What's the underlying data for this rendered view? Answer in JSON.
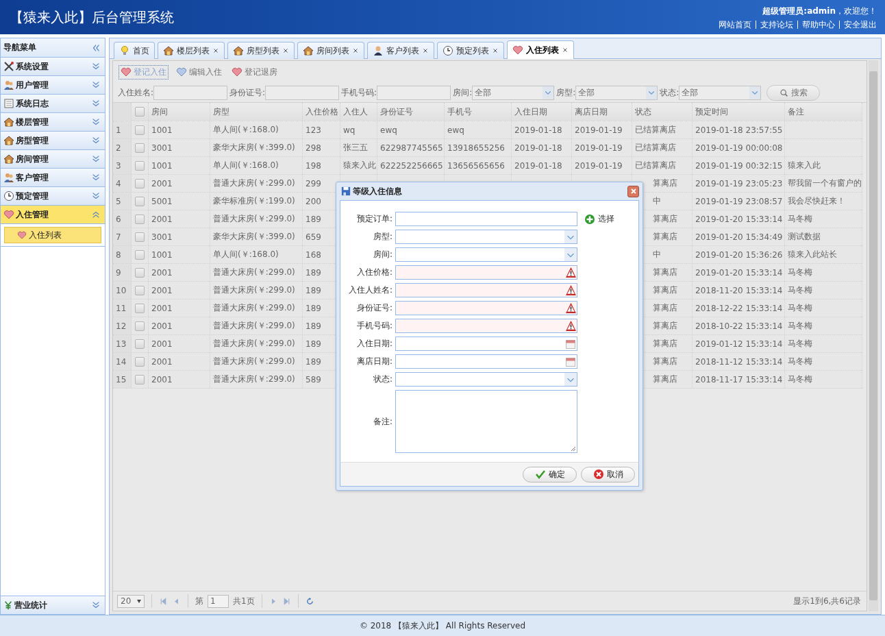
{
  "header": {
    "title": "【猿来入此】后台管理系统",
    "welcome": "**超级管理员:admin**，欢迎您！",
    "links": [
      "网站首页",
      "支持论坛",
      "帮助中心",
      "安全退出"
    ]
  },
  "sidebar": {
    "title": "导航菜单",
    "items": [
      {
        "label": "系统设置",
        "expanded": false,
        "selected": false
      },
      {
        "label": "用户管理",
        "expanded": false,
        "selected": false
      },
      {
        "label": "系统日志",
        "expanded": false,
        "selected": false
      },
      {
        "label": "楼层管理",
        "expanded": false,
        "selected": false
      },
      {
        "label": "房型管理",
        "expanded": false,
        "selected": false
      },
      {
        "label": "房间管理",
        "expanded": false,
        "selected": false
      },
      {
        "label": "客户管理",
        "expanded": false,
        "selected": false
      },
      {
        "label": "预定管理",
        "expanded": false,
        "selected": false
      },
      {
        "label": "入住管理",
        "expanded": true,
        "selected": true,
        "children": [
          {
            "label": "入住列表",
            "selected": true
          }
        ]
      }
    ],
    "bottom_item": {
      "label": "营业统计",
      "expanded": false
    }
  },
  "tabs": [
    {
      "label": "首页",
      "closable": false,
      "selected": false
    },
    {
      "label": "楼层列表",
      "closable": true,
      "selected": false
    },
    {
      "label": "房型列表",
      "closable": true,
      "selected": false
    },
    {
      "label": "房间列表",
      "closable": true,
      "selected": false
    },
    {
      "label": "客户列表",
      "closable": true,
      "selected": false
    },
    {
      "label": "预定列表",
      "closable": true,
      "selected": false
    },
    {
      "label": "入住列表",
      "closable": true,
      "selected": true
    }
  ],
  "toolbar": [
    {
      "label": "登记入住",
      "focused": true
    },
    {
      "label": "编辑入住",
      "focused": false
    },
    {
      "label": "登记退房",
      "focused": false
    }
  ],
  "search": {
    "fields": [
      {
        "label": "入住姓名:",
        "kind": "text"
      },
      {
        "label": "身份证号:",
        "kind": "text"
      },
      {
        "label": "手机号码:",
        "kind": "text"
      },
      {
        "label": "房间:",
        "kind": "select",
        "value": "全部"
      },
      {
        "label": "房型:",
        "kind": "select",
        "value": "全部"
      },
      {
        "label": "状态:",
        "kind": "select",
        "value": "全部"
      }
    ],
    "button": "搜索"
  },
  "table": {
    "header_checked": false,
    "columns": [
      "房间",
      "房型",
      "入住价格",
      "入住人",
      "身份证号",
      "手机号",
      "入住日期",
      "离店日期",
      "状态",
      "预定时间",
      "备注"
    ],
    "rows": [
      {
        "no": "1",
        "checked": false,
        "room": "1001",
        "type": "单人间(￥:168.0)",
        "price": "123",
        "guest": "wq",
        "id_no": "ewq",
        "phone": "ewq",
        "checkin": "2019-01-18",
        "checkout": "2019-01-19",
        "status": "已结算离店",
        "status_cut": false,
        "booked": "2019-01-18 23:57:55"
      },
      {
        "no": "2",
        "checked": false,
        "room": "3001",
        "type": "豪华大床房(￥:399.0)",
        "price": "298",
        "guest": "张三五",
        "id_no": "622987745565",
        "phone": "13918655256",
        "checkin": "2019-01-18",
        "checkout": "2019-01-19",
        "status": "已结算离店",
        "status_cut": false,
        "booked": "2019-01-19 00:00:08"
      },
      {
        "no": "3",
        "checked": false,
        "room": "1001",
        "type": "单人间(￥:168.0)",
        "price": "198",
        "guest": "猿来入此",
        "id_no": "622252256665",
        "phone": "13656565656",
        "checkin": "2019-01-18",
        "checkout": "2019-01-19",
        "status": "已结算离店",
        "status_cut": false,
        "booked": "2019-01-19 00:32:15",
        "note": "猿来入此"
      },
      {
        "no": "4",
        "checked": false,
        "room": "2001",
        "type": "普通大床房(￥:299.0)",
        "price": "299",
        "status": "算离店",
        "status_cut": true,
        "booked": "2019-01-19 23:05:23",
        "note": "帮我留一个有窗户的"
      },
      {
        "no": "5",
        "checked": false,
        "room": "5001",
        "type": "豪华标准房(￥:199.0)",
        "price": "200",
        "status": "中",
        "status_cut": true,
        "booked": "2019-01-19 23:08:57",
        "note": "我会尽快赶来！"
      },
      {
        "no": "6",
        "checked": false,
        "room": "2001",
        "type": "普通大床房(￥:299.0)",
        "price": "189",
        "status": "算离店",
        "status_cut": true,
        "booked": "2019-01-20 15:33:14",
        "note": "马冬梅"
      },
      {
        "no": "7",
        "checked": false,
        "room": "3001",
        "type": "豪华大床房(￥:399.0)",
        "price": "659",
        "status": "算离店",
        "status_cut": true,
        "booked": "2019-01-20 15:34:49",
        "note": "测试数据"
      },
      {
        "no": "8",
        "checked": false,
        "room": "1001",
        "type": "单人间(￥:168.0)",
        "price": "168",
        "status": "中",
        "status_cut": true,
        "booked": "2019-01-20 15:36:26",
        "note": "猿来入此站长"
      },
      {
        "no": "9",
        "checked": false,
        "room": "2001",
        "type": "普通大床房(￥:299.0)",
        "price": "189",
        "status": "算离店",
        "status_cut": true,
        "booked": "2019-01-20 15:33:14",
        "note": "马冬梅"
      },
      {
        "no": "10",
        "checked": false,
        "room": "2001",
        "type": "普通大床房(￥:299.0)",
        "price": "189",
        "status": "算离店",
        "status_cut": true,
        "booked": "2018-11-20 15:33:14",
        "note": "马冬梅"
      },
      {
        "no": "11",
        "checked": false,
        "room": "2001",
        "type": "普通大床房(￥:299.0)",
        "price": "189",
        "status": "算离店",
        "status_cut": true,
        "booked": "2018-12-22 15:33:14",
        "note": "马冬梅"
      },
      {
        "no": "12",
        "checked": false,
        "room": "2001",
        "type": "普通大床房(￥:299.0)",
        "price": "189",
        "status": "算离店",
        "status_cut": true,
        "booked": "2018-10-22 15:33:14",
        "note": "马冬梅"
      },
      {
        "no": "13",
        "checked": false,
        "room": "2001",
        "type": "普通大床房(￥:299.0)",
        "price": "189",
        "status": "算离店",
        "status_cut": true,
        "booked": "2019-01-12 15:33:14",
        "note": "马冬梅"
      },
      {
        "no": "14",
        "checked": false,
        "room": "2001",
        "type": "普通大床房(￥:299.0)",
        "price": "189",
        "status": "算离店",
        "status_cut": true,
        "booked": "2018-11-12 15:33:14",
        "note": "马冬梅"
      },
      {
        "no": "15",
        "checked": false,
        "room": "2001",
        "type": "普通大床房(￥:299.0)",
        "price": "589",
        "status": "算离店",
        "status_cut": true,
        "booked": "2018-11-17 15:33:14",
        "note": "马冬梅"
      }
    ]
  },
  "pager": {
    "page_size": "20",
    "page_before": "第",
    "page": "1",
    "page_after": "共1页",
    "summary": "显示1到6,共6记录"
  },
  "dialog": {
    "title": "等级入住信息",
    "pick_link": "选择",
    "fields": [
      {
        "label": "预定订单:",
        "kind": "text",
        "invalid": false
      },
      {
        "label": "房型:",
        "kind": "select",
        "invalid": false
      },
      {
        "label": "房间:",
        "kind": "select",
        "invalid": false
      },
      {
        "label": "入住价格:",
        "kind": "text",
        "invalid": true
      },
      {
        "label": "入住人姓名:",
        "kind": "text",
        "invalid": true
      },
      {
        "label": "身份证号:",
        "kind": "text",
        "invalid": true
      },
      {
        "label": "手机号码:",
        "kind": "text",
        "invalid": true
      },
      {
        "label": "入住日期:",
        "kind": "date",
        "invalid": false
      },
      {
        "label": "离店日期:",
        "kind": "date",
        "invalid": false
      },
      {
        "label": "状态:",
        "kind": "select",
        "invalid": false
      },
      {
        "label": "备注:",
        "kind": "textarea",
        "invalid": false
      }
    ],
    "buttons": [
      {
        "label": "确定",
        "kind": "ok"
      },
      {
        "label": "取消",
        "kind": "cancel"
      }
    ]
  },
  "footer": "© 2018 【猿来入此】 All Rights Reserved"
}
